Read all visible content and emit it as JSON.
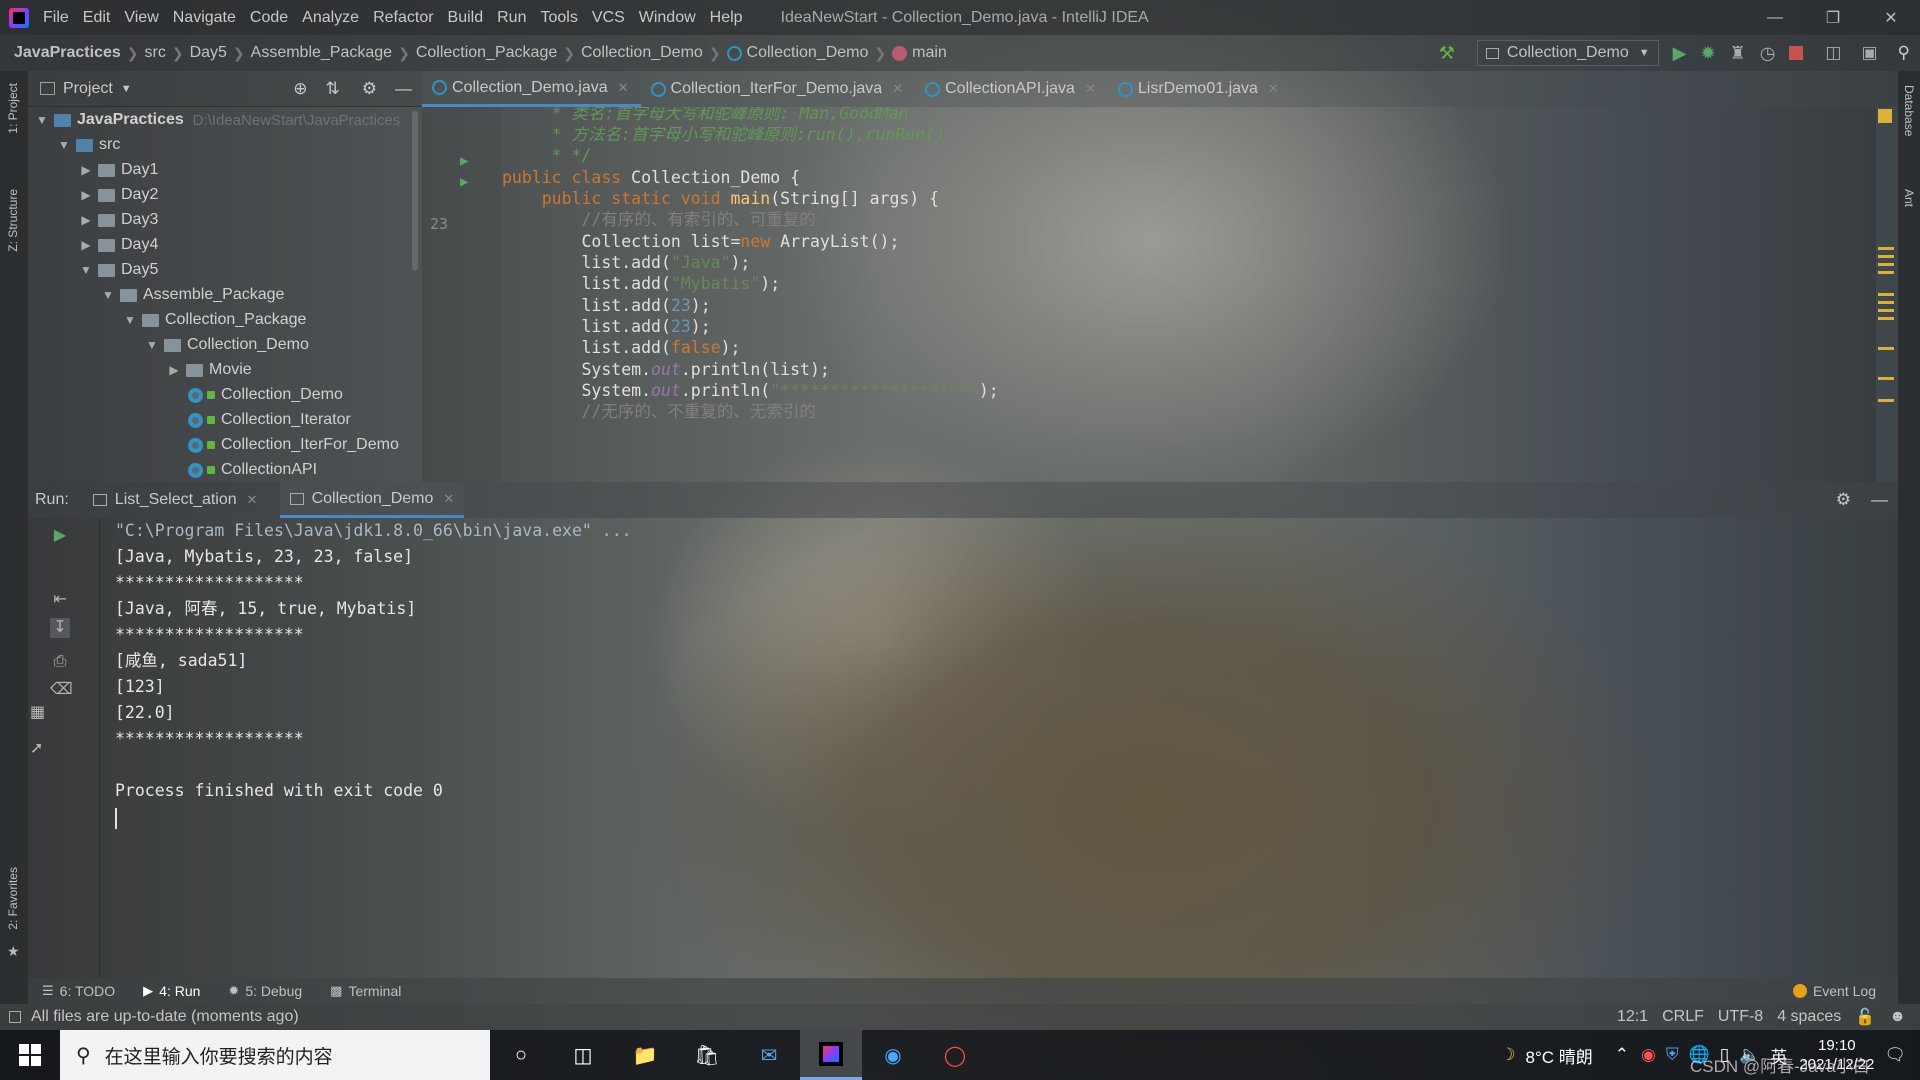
{
  "menubar": {
    "items": [
      "File",
      "Edit",
      "View",
      "Navigate",
      "Code",
      "Analyze",
      "Refactor",
      "Build",
      "Run",
      "Tools",
      "VCS",
      "Window",
      "Help"
    ],
    "window_title": "IdeaNewStart - Collection_Demo.java - IntelliJ IDEA"
  },
  "navbar": {
    "breadcrumbs": [
      "JavaPractices",
      "src",
      "Day5",
      "Assemble_Package",
      "Collection_Package",
      "Collection_Demo",
      "Collection_Demo",
      "main"
    ],
    "run_config": "Collection_Demo"
  },
  "left_stripe": {
    "project_label": "1: Project",
    "structure_label": "Z: Structure",
    "favorites_label": "2: Favorites"
  },
  "right_stripe": {
    "database_label": "Database",
    "ant_label": "Ant"
  },
  "project": {
    "header": "Project",
    "root_name": "JavaPractices",
    "root_path": "D:\\IdeaNewStart\\JavaPractices",
    "nodes": [
      "src",
      "Day1",
      "Day2",
      "Day3",
      "Day4",
      "Day5",
      "Assemble_Package",
      "Collection_Package",
      "Collection_Demo",
      "Movie",
      "Collection_Demo",
      "Collection_Iterator",
      "Collection_IterFor_Demo",
      "CollectionAPI"
    ]
  },
  "tabs": [
    "Collection_Demo.java",
    "Collection_IterFor_Demo.java",
    "CollectionAPI.java",
    "LisrDemo01.java"
  ],
  "editor": {
    "current_line": "23",
    "lines": [
      "     * 类名:首字母大写和驼峰原则: Man,GoodMan",
      "     * 方法名:首字母小写和驼峰原则:run(),runRun()",
      "     * */",
      "public class Collection_Demo {",
      "    public static void main(String[] args) {",
      "        //有序的、有索引的、可重复的",
      "        Collection list=new ArrayList();",
      "        list.add(\"Java\");",
      "        list.add(\"Mybatis\");",
      "        list.add(23);",
      "        list.add(23);",
      "        list.add(false);",
      "        System.out.println(list);",
      "        System.out.println(\"*******************\");",
      "        //无序的、不重复的、无索引的"
    ]
  },
  "run": {
    "label": "Run:",
    "tabs": [
      "List_Select_ation",
      "Collection_Demo"
    ],
    "output": [
      "\"C:\\Program Files\\Java\\jdk1.8.0_66\\bin\\java.exe\" ...",
      "[Java, Mybatis, 23, 23, false]",
      "*******************",
      "[Java, 阿春, 15, true, Mybatis]",
      "*******************",
      "[咸鱼, sada51]",
      "[123]",
      "[22.0]",
      "*******************",
      "",
      "Process finished with exit code 0"
    ]
  },
  "toolwindows": {
    "todo": "6: TODO",
    "run": "4: Run",
    "debug": "5: Debug",
    "terminal": "Terminal",
    "event_log": "Event Log"
  },
  "status": {
    "message": "All files are up-to-date (moments ago)",
    "position": "12:1",
    "line_sep": "CRLF",
    "encoding": "UTF-8",
    "indent": "4 spaces"
  },
  "taskbar": {
    "search_placeholder": "在这里输入你要搜索的内容",
    "weather": "8°C 晴朗",
    "ime": "英",
    "time": "19:10",
    "date": "2021/12/22",
    "watermark": "CSDN @阿春-Java小白"
  },
  "colors": {
    "keyword": "#cc7832",
    "comment": "#808080",
    "doc_comment": "#629755",
    "string": "#6a8759",
    "number": "#6897bb",
    "field": "#9876aa",
    "method": "#ffc66d",
    "accent": "#4a88c7"
  }
}
